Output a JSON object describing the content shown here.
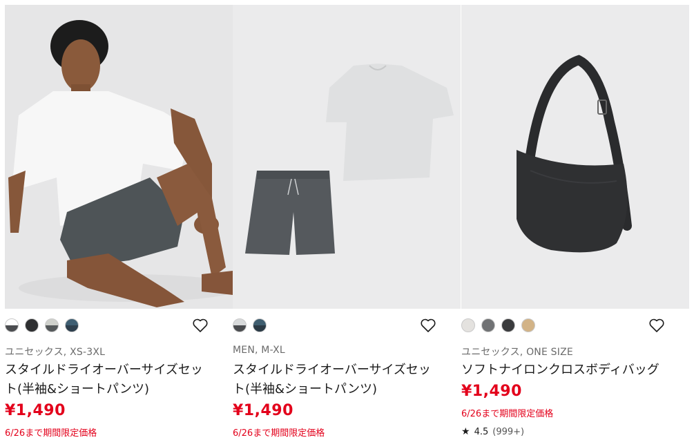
{
  "products": [
    {
      "swatches": [
        {
          "top": "#ffffff",
          "bottom": "#4b4d50"
        },
        {
          "top": "#2e2f31",
          "bottom": "#2e2f31"
        },
        {
          "top": "#cfd1cc",
          "bottom": "#55595b"
        },
        {
          "top": "#3e5e72",
          "bottom": "#2e3f4d"
        }
      ],
      "labels": "ユニセックス, XS-3XL",
      "name": "スタイルドライオーバーサイズセット(半袖&ショートパンツ)",
      "price": "¥1,490",
      "note": "6/26まで期間限定価格"
    },
    {
      "swatches": [
        {
          "top": "#d8dadb",
          "bottom": "#4a4c4f"
        },
        {
          "top": "#3f5e70",
          "bottom": "#2b3a45"
        }
      ],
      "labels": "MEN, M-XL",
      "name": "スタイルドライオーバーサイズセット(半袖&ショートパンツ)",
      "price": "¥1,490",
      "note": "6/26まで期間限定価格"
    },
    {
      "swatches": [
        {
          "top": "#e4e2df",
          "bottom": "#e4e2df"
        },
        {
          "top": "#707274",
          "bottom": "#707274"
        },
        {
          "top": "#3a3b3d",
          "bottom": "#3a3b3d"
        },
        {
          "top": "#d2b387",
          "bottom": "#d2b387"
        }
      ],
      "labels": "ユニセックス, ONE SIZE",
      "name": "ソフトナイロンクロスボディバッグ",
      "price": "¥1,490",
      "note": "6/26まで期間限定価格",
      "rating": "4.5",
      "review_count": "(999+)"
    }
  ],
  "icons": {
    "favorite": "heart-outline-icon",
    "star": "star-icon"
  },
  "colors": {
    "sale_red": "#e3001b",
    "image_bg": "#e9e9ea"
  }
}
